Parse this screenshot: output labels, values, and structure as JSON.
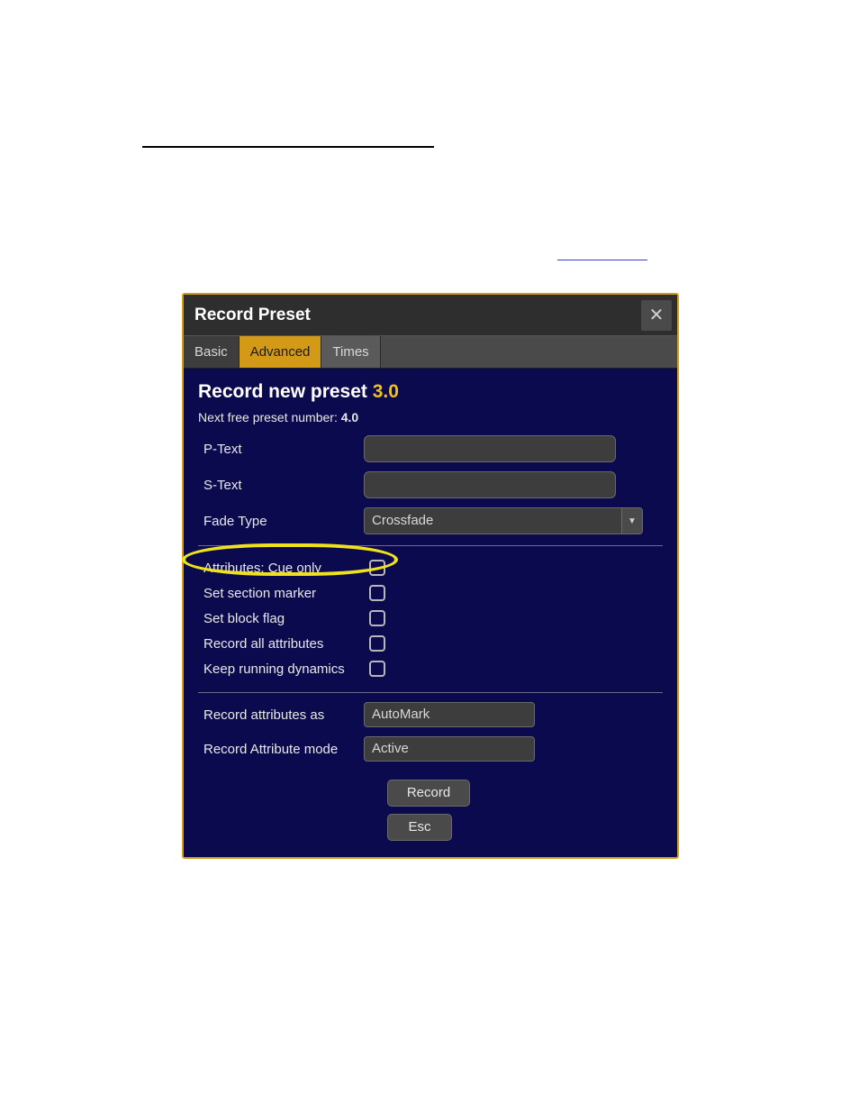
{
  "dialog_title": "Record Preset",
  "tabs": {
    "basic": "Basic",
    "advanced": "Advanced",
    "times": "Times"
  },
  "heading_prefix": "Record new preset ",
  "heading_num": "3.0",
  "next_free_label": "Next free preset number: ",
  "next_free_value": "4.0",
  "ptext_label": "P-Text",
  "ptext_value": "",
  "stext_label": "S-Text",
  "stext_value": "",
  "fade_type_label": "Fade Type",
  "fade_type_value": "Crossfade",
  "checks": {
    "cue_only": "Attributes: Cue only",
    "section_marker": "Set section marker",
    "block_flag": "Set block flag",
    "record_all": "Record all attributes",
    "keep_dynamics": "Keep running dynamics"
  },
  "record_attrs_as_label": "Record attributes as",
  "record_attrs_as_value": "AutoMark",
  "record_attr_mode_label": "Record Attribute mode",
  "record_attr_mode_value": "Active",
  "btn_record": "Record",
  "btn_esc": "Esc"
}
